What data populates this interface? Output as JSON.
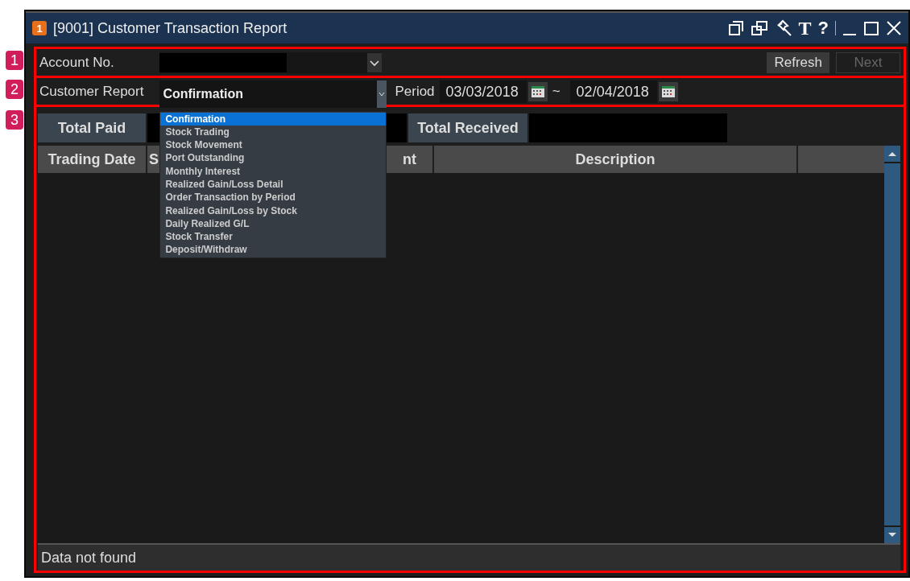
{
  "window": {
    "title": "[9001] Customer Transaction Report",
    "badge": "1",
    "tool_glyphs": [
      "T",
      "?"
    ]
  },
  "annotations": [
    {
      "label": "1"
    },
    {
      "label": "2"
    },
    {
      "label": "3"
    }
  ],
  "account": {
    "label": "Account No."
  },
  "buttons": [
    {
      "label": "Refresh",
      "disabled": false
    },
    {
      "label": "Next",
      "disabled": true
    }
  ],
  "report": {
    "label": "Customer Report",
    "value": "Confirmation",
    "options": [
      {
        "label": "Confirmation",
        "selected": true
      },
      {
        "label": "Stock Trading",
        "selected": false
      },
      {
        "label": "Stock Movement",
        "selected": false
      },
      {
        "label": "Port Outstanding",
        "selected": false
      },
      {
        "label": "Monthly Interest",
        "selected": false
      },
      {
        "label": "Realized Gain/Loss Detail",
        "selected": false
      },
      {
        "label": "Order Transaction by Period",
        "selected": false
      },
      {
        "label": "Realized Gain/Loss by Stock",
        "selected": false
      },
      {
        "label": "Daily Realized G/L",
        "selected": false
      },
      {
        "label": "Stock Transfer",
        "selected": false
      },
      {
        "label": "Deposit/Withdraw",
        "selected": false
      }
    ]
  },
  "period": {
    "label": "Period",
    "from": "03/03/2018",
    "separator": "~",
    "to": "02/04/2018"
  },
  "totals": [
    {
      "label": "Total Paid"
    },
    {
      "label": "Total Received"
    }
  ],
  "table": {
    "columns": [
      {
        "label": "Trading Date"
      },
      {
        "label": "S"
      },
      {
        "label": "nt"
      },
      {
        "label": "Description"
      }
    ]
  },
  "status_bar": "Data not found"
}
